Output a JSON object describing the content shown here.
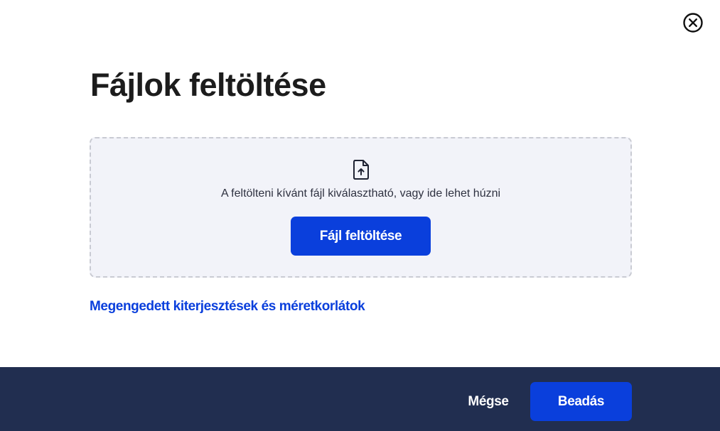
{
  "dialog": {
    "title": "Fájlok feltöltése",
    "close_icon": "close-circle-icon"
  },
  "dropzone": {
    "icon": "file-upload-icon",
    "instruction": "A feltölteni kívánt fájl kiválasztható, vagy ide lehet húzni",
    "upload_button_label": "Fájl feltöltése"
  },
  "limits_link": {
    "label": "Megengedett kiterjesztések és méretkorlátok"
  },
  "footer": {
    "cancel_label": "Mégse",
    "submit_label": "Beadás"
  },
  "colors": {
    "accent": "#0a3fdc",
    "footer_bg": "#212e50",
    "dropzone_bg": "#f2f3f9",
    "dropzone_border": "#c9cbd3",
    "title_text": "#1c1c1c"
  }
}
